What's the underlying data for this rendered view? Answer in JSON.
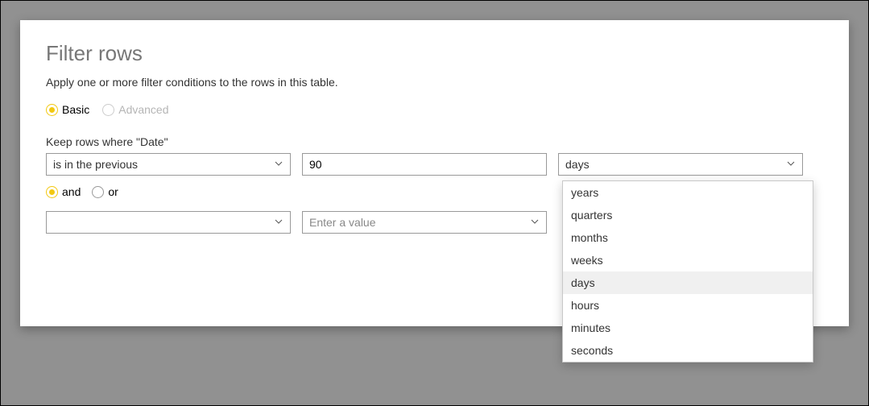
{
  "dialog": {
    "title": "Filter rows",
    "subtitle": "Apply one or more filter conditions to the rows in this table."
  },
  "mode": {
    "basic": "Basic",
    "advanced": "Advanced"
  },
  "keep_label": "Keep rows where \"Date\"",
  "row1": {
    "operator": "is in the previous",
    "value": "90",
    "unit": "days"
  },
  "logic": {
    "and": "and",
    "or": "or"
  },
  "row2": {
    "operator": "",
    "value_placeholder": "Enter a value"
  },
  "unit_options": [
    "years",
    "quarters",
    "months",
    "weeks",
    "days",
    "hours",
    "minutes",
    "seconds"
  ],
  "unit_highlighted": "days"
}
